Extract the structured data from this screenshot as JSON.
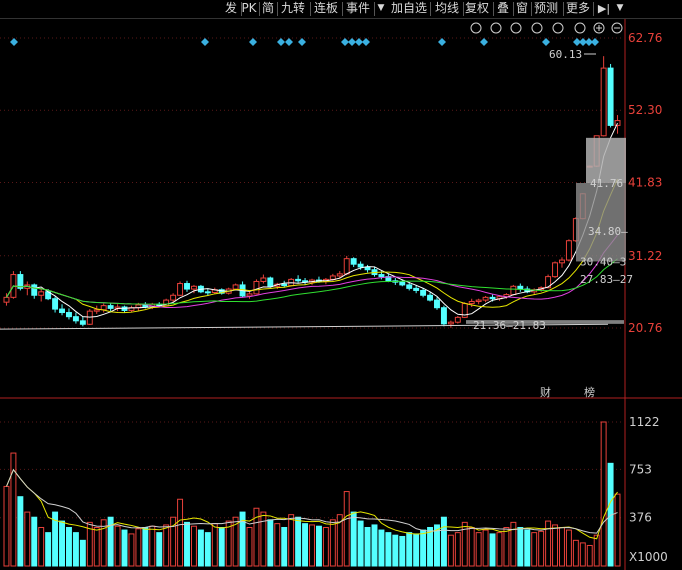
{
  "toolbar": {
    "items": [
      "发",
      "PK",
      "简",
      "九转",
      "连板",
      "事件",
      "加自选",
      "均线",
      "复权",
      "叠",
      "窗",
      "预测",
      "更多"
    ],
    "dropdown_arrow": "▼",
    "pin_icon": "▶|",
    "zoom_in": "⊕",
    "zoom_out": "⊖"
  },
  "price_axis": {
    "labels": [
      "62.76",
      "52.30",
      "41.83",
      "31.22",
      "20.76"
    ],
    "values": [
      62.76,
      52.3,
      41.83,
      31.22,
      20.76
    ]
  },
  "volume_axis": {
    "labels": [
      "1122",
      "753",
      "376",
      "X1000"
    ],
    "values": [
      1122,
      753,
      376
    ]
  },
  "annotations": {
    "high_label": "60.13",
    "low_range": "21.36—21.83",
    "range_1": "41.76",
    "range_2": "34.80—",
    "range_3": "30.40—3",
    "range_4": "27.83—27",
    "event_cai": "财",
    "event_bang": "榜"
  },
  "colors": {
    "up": "#e8413a",
    "down": "#54ffff",
    "ma5": "#ffffff",
    "ma10": "#e6e600",
    "ma20": "#e040e0",
    "ma30": "#30e030",
    "ma60": "#d0d0d0",
    "marker": "#3ab0e0"
  },
  "chart_data": {
    "type": "candlestick",
    "note_units": "price in CNY, volume in thousands (X1000)",
    "candles": [
      [
        24.5,
        25.8,
        24.0,
        25.2,
        620
      ],
      [
        25.2,
        29.0,
        25.0,
        28.5,
        880
      ],
      [
        28.5,
        29.0,
        26.2,
        26.5,
        540
      ],
      [
        26.5,
        27.5,
        25.5,
        27.0,
        420
      ],
      [
        27.0,
        27.2,
        25.0,
        25.5,
        380
      ],
      [
        25.5,
        26.5,
        24.6,
        26.0,
        300
      ],
      [
        26.0,
        26.4,
        24.8,
        25.0,
        260
      ],
      [
        25.0,
        25.3,
        23.0,
        23.5,
        420
      ],
      [
        23.5,
        24.2,
        22.6,
        23.0,
        350
      ],
      [
        23.0,
        23.6,
        22.0,
        22.4,
        300
      ],
      [
        22.4,
        23.0,
        21.4,
        21.8,
        260
      ],
      [
        21.8,
        22.4,
        21.0,
        21.3,
        200
      ],
      [
        21.3,
        23.5,
        21.2,
        23.2,
        340
      ],
      [
        23.2,
        24.0,
        22.8,
        23.4,
        300
      ],
      [
        23.4,
        24.3,
        23.0,
        24.0,
        360
      ],
      [
        24.0,
        24.4,
        23.0,
        23.6,
        380
      ],
      [
        23.6,
        24.2,
        23.2,
        23.8,
        310
      ],
      [
        23.8,
        24.0,
        23.0,
        23.3,
        280
      ],
      [
        23.3,
        24.0,
        23.0,
        23.7,
        250
      ],
      [
        23.7,
        24.4,
        23.2,
        24.1,
        290
      ],
      [
        24.1,
        24.5,
        23.6,
        23.8,
        300
      ],
      [
        23.8,
        24.4,
        23.5,
        24.2,
        310
      ],
      [
        24.2,
        24.5,
        23.8,
        24.0,
        260
      ],
      [
        24.0,
        25.0,
        23.9,
        24.8,
        320
      ],
      [
        24.8,
        25.8,
        24.5,
        25.5,
        380
      ],
      [
        25.5,
        27.5,
        25.4,
        27.2,
        520
      ],
      [
        27.2,
        27.6,
        26.0,
        26.4,
        340
      ],
      [
        26.4,
        27.0,
        25.8,
        26.8,
        310
      ],
      [
        26.8,
        27.0,
        25.8,
        26.0,
        280
      ],
      [
        26.0,
        26.4,
        25.4,
        25.9,
        260
      ],
      [
        25.9,
        26.6,
        25.7,
        26.3,
        330
      ],
      [
        26.3,
        26.5,
        25.6,
        25.8,
        300
      ],
      [
        25.8,
        26.6,
        25.6,
        26.4,
        350
      ],
      [
        26.4,
        27.2,
        26.2,
        27.0,
        380
      ],
      [
        27.0,
        27.5,
        25.2,
        25.4,
        420
      ],
      [
        25.4,
        26.0,
        25.0,
        25.7,
        300
      ],
      [
        25.7,
        27.8,
        25.6,
        27.5,
        450
      ],
      [
        27.5,
        28.5,
        27.2,
        28.0,
        420
      ],
      [
        28.0,
        28.2,
        26.6,
        26.8,
        360
      ],
      [
        26.8,
        27.3,
        26.4,
        27.1,
        330
      ],
      [
        27.1,
        27.6,
        26.6,
        26.9,
        300
      ],
      [
        26.9,
        28.0,
        26.8,
        27.8,
        400
      ],
      [
        27.8,
        28.4,
        27.3,
        27.6,
        380
      ],
      [
        27.6,
        28.0,
        27.0,
        27.4,
        330
      ],
      [
        27.4,
        27.9,
        27.0,
        27.7,
        320
      ],
      [
        27.7,
        28.2,
        27.3,
        27.5,
        310
      ],
      [
        27.5,
        28.0,
        27.1,
        27.8,
        300
      ],
      [
        27.8,
        28.6,
        27.6,
        28.3,
        360
      ],
      [
        28.3,
        29.0,
        28.0,
        28.6,
        400
      ],
      [
        28.6,
        31.2,
        28.4,
        30.8,
        580
      ],
      [
        30.8,
        31.0,
        29.6,
        30.0,
        420
      ],
      [
        30.0,
        30.4,
        29.2,
        29.6,
        350
      ],
      [
        29.6,
        29.9,
        28.8,
        29.2,
        300
      ],
      [
        29.2,
        29.6,
        28.2,
        28.5,
        320
      ],
      [
        28.5,
        29.0,
        27.8,
        28.2,
        280
      ],
      [
        28.2,
        28.6,
        27.4,
        27.6,
        260
      ],
      [
        27.6,
        28.0,
        27.0,
        27.4,
        240
      ],
      [
        27.4,
        27.8,
        26.8,
        27.0,
        230
      ],
      [
        27.0,
        27.4,
        26.2,
        26.5,
        260
      ],
      [
        26.5,
        27.0,
        25.8,
        26.2,
        250
      ],
      [
        26.2,
        26.5,
        25.2,
        25.5,
        280
      ],
      [
        25.5,
        25.9,
        24.6,
        24.8,
        300
      ],
      [
        24.8,
        25.2,
        23.4,
        23.7,
        320
      ],
      [
        23.7,
        24.0,
        21.0,
        21.36,
        380
      ],
      [
        21.36,
        21.83,
        20.8,
        21.6,
        240
      ],
      [
        21.6,
        22.5,
        21.4,
        22.3,
        260
      ],
      [
        22.3,
        24.5,
        22.2,
        24.3,
        340
      ],
      [
        24.3,
        25.0,
        23.8,
        24.6,
        300
      ],
      [
        24.6,
        25.0,
        24.2,
        24.8,
        260
      ],
      [
        24.8,
        25.4,
        24.5,
        25.2,
        280
      ],
      [
        25.2,
        25.6,
        24.6,
        25.0,
        250
      ],
      [
        25.0,
        25.5,
        24.7,
        25.3,
        260
      ],
      [
        25.3,
        25.8,
        25.0,
        25.6,
        300
      ],
      [
        25.6,
        27.0,
        25.5,
        26.8,
        340
      ],
      [
        26.8,
        27.2,
        26.0,
        26.4,
        300
      ],
      [
        26.4,
        26.8,
        25.8,
        26.0,
        280
      ],
      [
        26.0,
        26.5,
        25.6,
        26.3,
        260
      ],
      [
        26.3,
        26.8,
        26.0,
        26.6,
        270
      ],
      [
        26.6,
        28.5,
        26.5,
        28.2,
        350
      ],
      [
        28.2,
        30.4,
        28.0,
        30.2,
        320
      ],
      [
        30.2,
        31.0,
        29.5,
        30.6,
        300
      ],
      [
        30.6,
        33.6,
        30.4,
        33.4,
        280
      ],
      [
        33.4,
        36.8,
        33.2,
        36.6,
        200
      ],
      [
        36.6,
        40.3,
        36.5,
        40.2,
        180
      ],
      [
        44.2,
        44.3,
        44.0,
        44.2,
        160
      ],
      [
        44.2,
        48.6,
        44.1,
        48.6,
        240
      ],
      [
        48.6,
        60.13,
        48.5,
        58.4,
        1122
      ],
      [
        58.4,
        59.0,
        49.8,
        50.1,
        800
      ],
      [
        50.1,
        51.6,
        48.9,
        50.8,
        560
      ]
    ]
  }
}
